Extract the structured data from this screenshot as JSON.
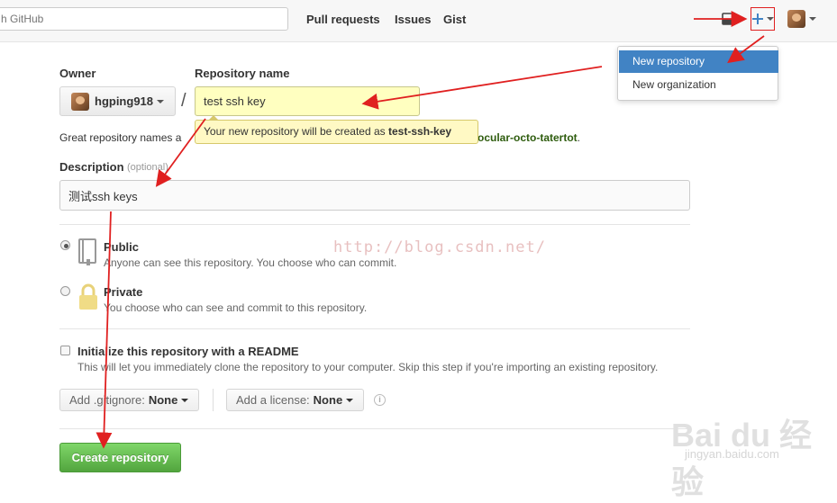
{
  "header": {
    "search_placeholder": "h GitHub",
    "nav": [
      "Pull requests",
      "Issues",
      "Gist"
    ]
  },
  "dropdown": {
    "items": [
      "New repository",
      "New organization"
    ]
  },
  "form": {
    "owner_label": "Owner",
    "repo_label": "Repository name",
    "owner_value": "hgping918",
    "slash": "/",
    "repo_value": "test ssh key",
    "tooltip_prefix": "Your new repository will be created as",
    "tooltip_name": "test-ssh-key",
    "help_text_start": "Great repository names a",
    "help_text_end": "ocular-octo-tatertot",
    "help_text_period": ".",
    "description_label": "Description",
    "description_optional": "(optional)",
    "description_value": "测试ssh keys",
    "public_title": "Public",
    "public_desc": "Anyone can see this repository. You choose who can commit.",
    "private_title": "Private",
    "private_desc": "You choose who can see and commit to this repository.",
    "readme_title": "Initialize this repository with a README",
    "readme_desc": "This will let you immediately clone the repository to your computer. Skip this step if you're importing an existing repository.",
    "gitignore_prefix": "Add .gitignore:",
    "gitignore_value": "None",
    "license_prefix": "Add a license:",
    "license_value": "None",
    "info_glyph": "i",
    "create_button": "Create repository"
  },
  "watermark": {
    "csdn": "http://blog.csdn.net/",
    "baidu": "Bai du 经验",
    "baidu_sub": "jingyan.baidu.com"
  },
  "colors": {
    "accent_blue": "#4183c4",
    "create_green": "#5cb546",
    "annotation_red": "#e02020",
    "tooltip_yellow": "#fff9c4"
  }
}
